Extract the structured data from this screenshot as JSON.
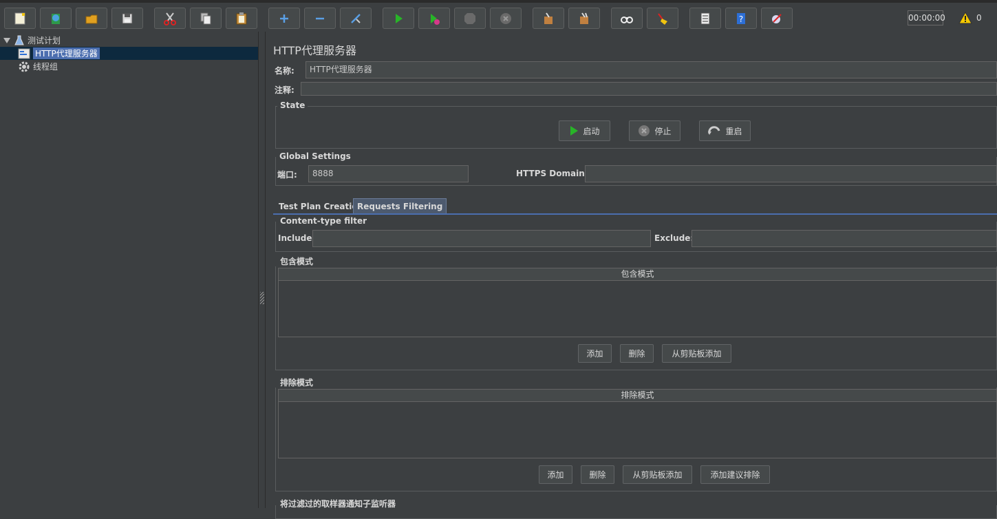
{
  "toolbar": {
    "buttons": [
      {
        "icon": "new-icon"
      },
      {
        "icon": "templates-icon"
      },
      {
        "icon": "open-icon"
      },
      {
        "icon": "save-icon"
      },
      {
        "icon": "cut-icon"
      },
      {
        "icon": "copy-icon"
      },
      {
        "icon": "paste-icon"
      },
      {
        "icon": "expand-icon"
      },
      {
        "icon": "collapse-icon"
      },
      {
        "icon": "toggle-icon"
      },
      {
        "icon": "start-icon"
      },
      {
        "icon": "start-no-pauses-icon"
      },
      {
        "icon": "stop-icon"
      },
      {
        "icon": "shutdown-icon"
      },
      {
        "icon": "clear-icon"
      },
      {
        "icon": "clear-all-icon"
      },
      {
        "icon": "search-icon"
      },
      {
        "icon": "reset-search-icon"
      },
      {
        "icon": "function-helper-icon"
      },
      {
        "icon": "help-icon"
      },
      {
        "icon": "remote-icon"
      }
    ],
    "timer": "00:00:00",
    "warning_count": "0"
  },
  "tree": {
    "items": [
      {
        "label": "测试计划"
      },
      {
        "label": "HTTP代理服务器"
      },
      {
        "label": "线程组"
      }
    ]
  },
  "panel": {
    "title": "HTTP代理服务器",
    "name_label": "名称:",
    "name_value": "HTTP代理服务器",
    "comment_label": "注释:",
    "comment_value": "",
    "state": {
      "title": "State",
      "start_label": "启动",
      "stop_label": "停止",
      "restart_label": "重启"
    },
    "global": {
      "title": "Global Settings",
      "port_label": "端口:",
      "port_value": "8888",
      "https_label": "HTTPS Domains:",
      "https_value": ""
    },
    "tabs": [
      {
        "label": "Test Plan Creation"
      },
      {
        "label": "Requests Filtering"
      }
    ],
    "content_filter": {
      "title": "Content-type filter",
      "include_label": "Include:",
      "include_value": "",
      "exclude_label": "Exclude:",
      "exclude_value": ""
    },
    "include_patterns": {
      "title": "包含模式",
      "column": "包含模式",
      "add_label": "添加",
      "delete_label": "删除",
      "paste_label": "从剪贴板添加"
    },
    "exclude_patterns": {
      "title": "排除模式",
      "column": "排除模式",
      "add_label": "添加",
      "delete_label": "删除",
      "paste_label": "从剪贴板添加",
      "suggest_label": "添加建议排除"
    },
    "notify_title": "将过滤过的取样器通知子监听器"
  },
  "colors": {
    "background": "#3c3f41",
    "selection": "#4b6eaf",
    "start_green": "#28b428",
    "warning_yellow": "#f5c800"
  }
}
